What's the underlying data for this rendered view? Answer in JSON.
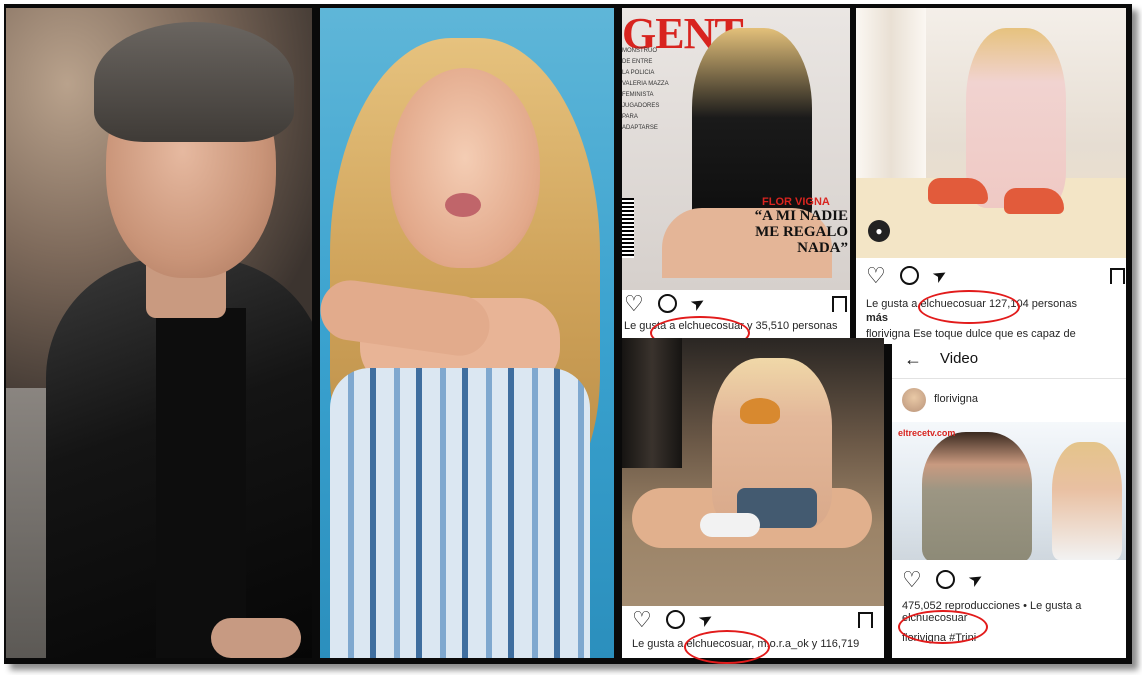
{
  "magazine": {
    "logo": "GENT",
    "cover_name": "FLOR VIGNA",
    "headline": "“A MI NADIE ME REGALO NADA”",
    "ticker_lines": [
      "MONSTRUO",
      "DE ENTRE",
      "LA POLICIA",
      "VALERIA MAZZA",
      "FEMINISTA",
      "JUGADORES",
      "PARA",
      "ADAPTARSE"
    ]
  },
  "posts": [
    {
      "id": "magazine-post",
      "likes_prefix": "Le gusta a",
      "liked_by": "elchuecosuar",
      "likes_suffix": "y 35,510 personas"
    },
    {
      "id": "bed-post",
      "likes_prefix": "Le gusta a",
      "liked_by": "elchuecosuar",
      "likes_suffix": "127,104 personas",
      "likes_more": "más",
      "caption_user": "florivigna",
      "caption_text": "Ese toque dulce que es capaz de"
    },
    {
      "id": "pizza-post",
      "likes_prefix": "Le gusta a",
      "liked_by": "elchuecosuar",
      "likes_suffix": ", m.o.r.a_ok y 116,719"
    }
  ],
  "video_post": {
    "back_icon": "arrow-left-icon",
    "header_title": "Video",
    "username": "florivigna",
    "watermark": "eltrecetv.com",
    "views": "475,052 reproducciones",
    "likes_prefix": "• Le gusta a",
    "liked_by": "elchuecosuar",
    "caption_user": "florivigna",
    "caption_tag": "#Trini"
  },
  "icons": {
    "like": "heart-icon",
    "comment": "comment-icon",
    "share": "send-icon",
    "save": "bookmark-icon",
    "user_tag": "person-icon"
  },
  "colors": {
    "highlight_circle": "#e21b1b",
    "magazine_red": "#d8241f",
    "photo_bg_blue": "#3aa2cf"
  }
}
